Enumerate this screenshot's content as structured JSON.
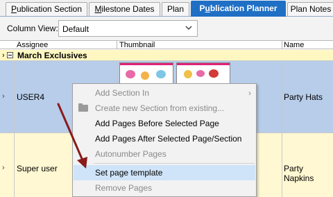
{
  "tabs": [
    {
      "label": "Publication Section",
      "ul": "P"
    },
    {
      "label": "Milestone Dates",
      "ul": "M"
    },
    {
      "label": "Plan",
      "ul": ""
    },
    {
      "label": "Publication Planner",
      "ul": "u"
    },
    {
      "label": "Plan Notes",
      "ul": ""
    }
  ],
  "viewbar": {
    "label": "Column View:",
    "selected": "Default"
  },
  "columns": {
    "assignee": "Assignee",
    "thumbnail": "Thumbnail",
    "name": "Name"
  },
  "group": {
    "title": "March Exclusives"
  },
  "rows": [
    {
      "assignee": "USER4",
      "name": "Party Hats"
    },
    {
      "assignee": "Super user",
      "name": "Party Napkins"
    }
  ],
  "menu": {
    "items": [
      {
        "label": "Add Section In",
        "enabled": false,
        "submenu": true
      },
      {
        "label": "Create new Section from existing...",
        "enabled": false
      },
      {
        "label": "Add Pages Before Selected Page",
        "enabled": true
      },
      {
        "label": "Add Pages After Selected Page/Section",
        "enabled": true
      },
      {
        "label": "Autonumber Pages",
        "enabled": false
      },
      {
        "label": "Set page template",
        "enabled": true,
        "highlighted": true
      },
      {
        "label": "Remove Pages",
        "enabled": false
      }
    ]
  },
  "colors": {
    "active_tab": "#1f6fc5",
    "selected_row": "#b7cdea",
    "group_row": "#fff7c2",
    "menu_highlight": "#cfe4f8",
    "arrow": "#8b1a1a"
  }
}
